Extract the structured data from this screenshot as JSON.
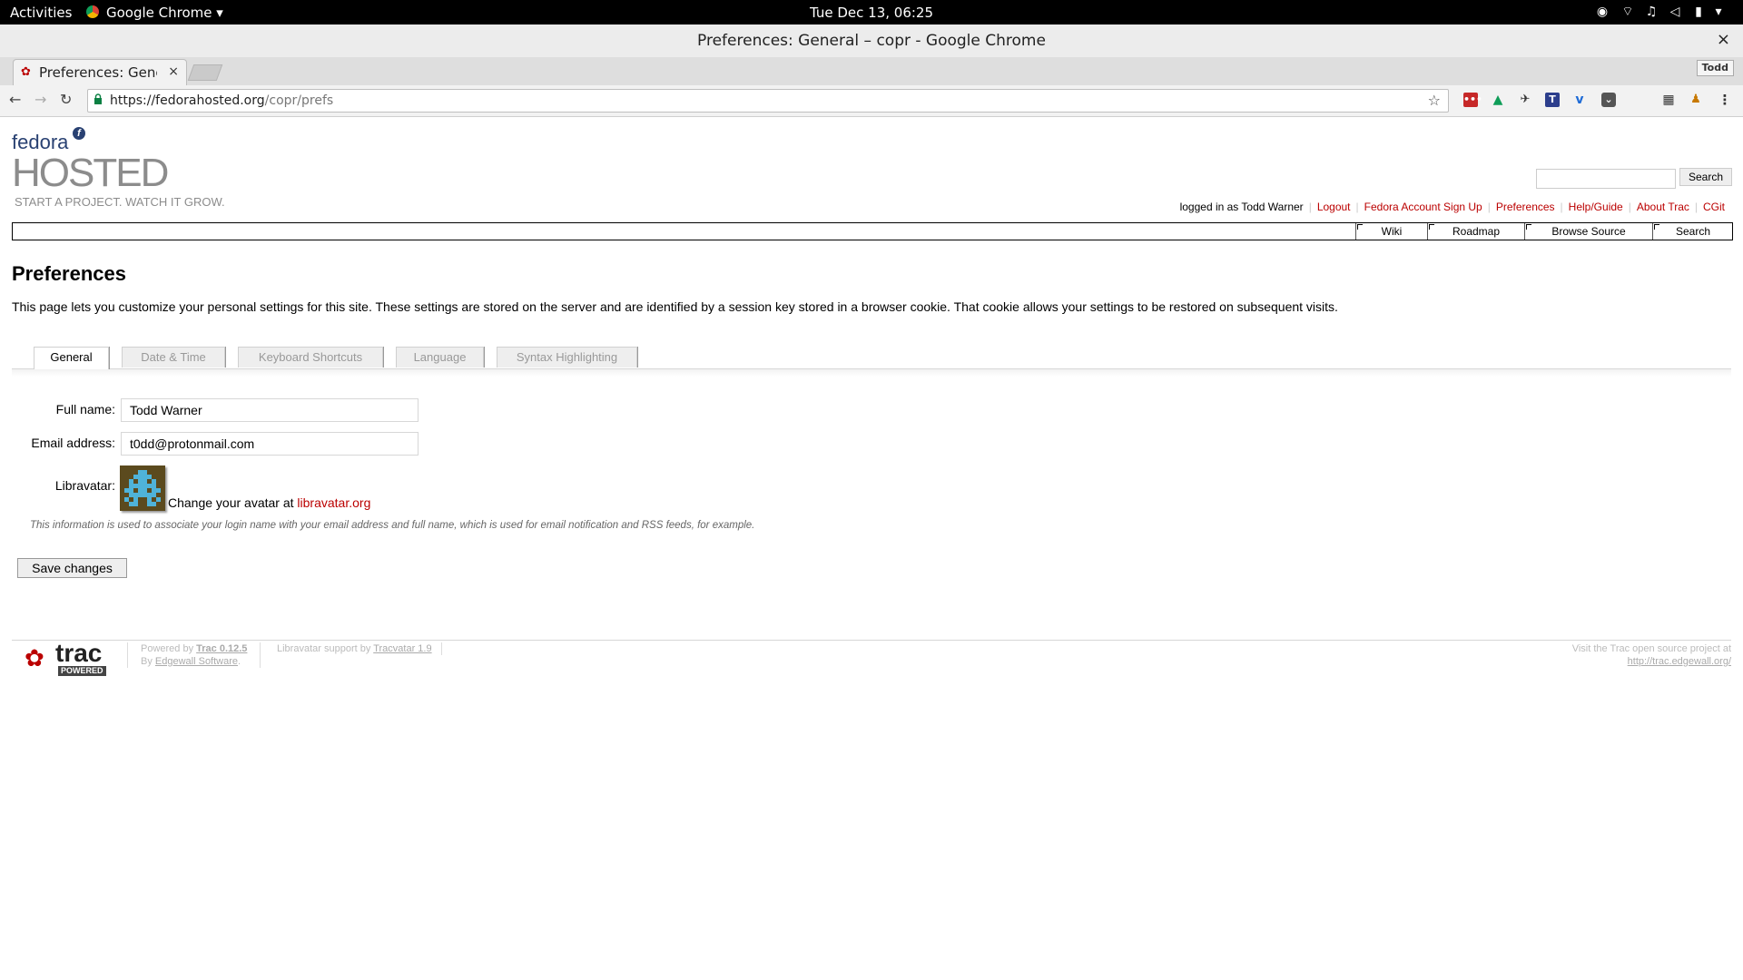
{
  "system_bar": {
    "activities": "Activities",
    "app_name": "Google Chrome",
    "clock": "Tue Dec 13, 06:25"
  },
  "window": {
    "title": "Preferences: General – copr - Google Chrome",
    "close": "×"
  },
  "browser": {
    "tab_title": "Preferences: General",
    "tab_close": "×",
    "profile_name": "Todd",
    "url_host": "https://fedorahosted.org",
    "url_path": "/copr/prefs"
  },
  "site": {
    "logo_fedora": "fedora",
    "logo_hosted": "HOSTED",
    "logo_tagline": "START A PROJECT. WATCH IT GROW.",
    "search_button": "Search",
    "meta_nav": {
      "logged_in": "logged in as Todd Warner",
      "links": [
        "Logout",
        "Fedora Account Sign Up",
        "Preferences",
        "Help/Guide",
        "About Trac",
        "CGit"
      ]
    },
    "main_nav": [
      "Wiki",
      "Roadmap",
      "Browse Source",
      "Search"
    ]
  },
  "prefs": {
    "heading": "Preferences",
    "intro": "This page lets you customize your personal settings for this site. These settings are stored on the server and are identified by a session key stored in a browser cookie. That cookie allows your settings to be restored on subsequent visits.",
    "tabs": [
      "General",
      "Date & Time",
      "Keyboard Shortcuts",
      "Language",
      "Syntax Highlighting"
    ],
    "active_tab": "General",
    "full_name_label": "Full name:",
    "full_name_value": "Todd Warner",
    "email_label": "Email address:",
    "email_value": "t0dd@protonmail.com",
    "libravatar_label": "Libravatar:",
    "avatar_text": "Change your avatar at ",
    "avatar_link": "libravatar.org",
    "hint": "This information is used to associate your login name with your email address and full name, which is used for email notification and RSS feeds, for example.",
    "save_button": "Save changes"
  },
  "footer": {
    "powered_by": "Powered by",
    "trac_version": "Trac 0.12.5",
    "by": "By",
    "edgewall": "Edgewall Software",
    "libravatar_support": "Libravatar support by",
    "tracvatar": "Tracvatar 1.9",
    "visit": "Visit the Trac open source project at",
    "trac_url": "http://trac.edgewall.org/",
    "trac_logo_text": "trac",
    "trac_logo_badge": "POWERED"
  },
  "colors": {
    "link": "#bb0000",
    "fedora_blue": "#294172",
    "hosted_grey": "#8c8c8c"
  }
}
